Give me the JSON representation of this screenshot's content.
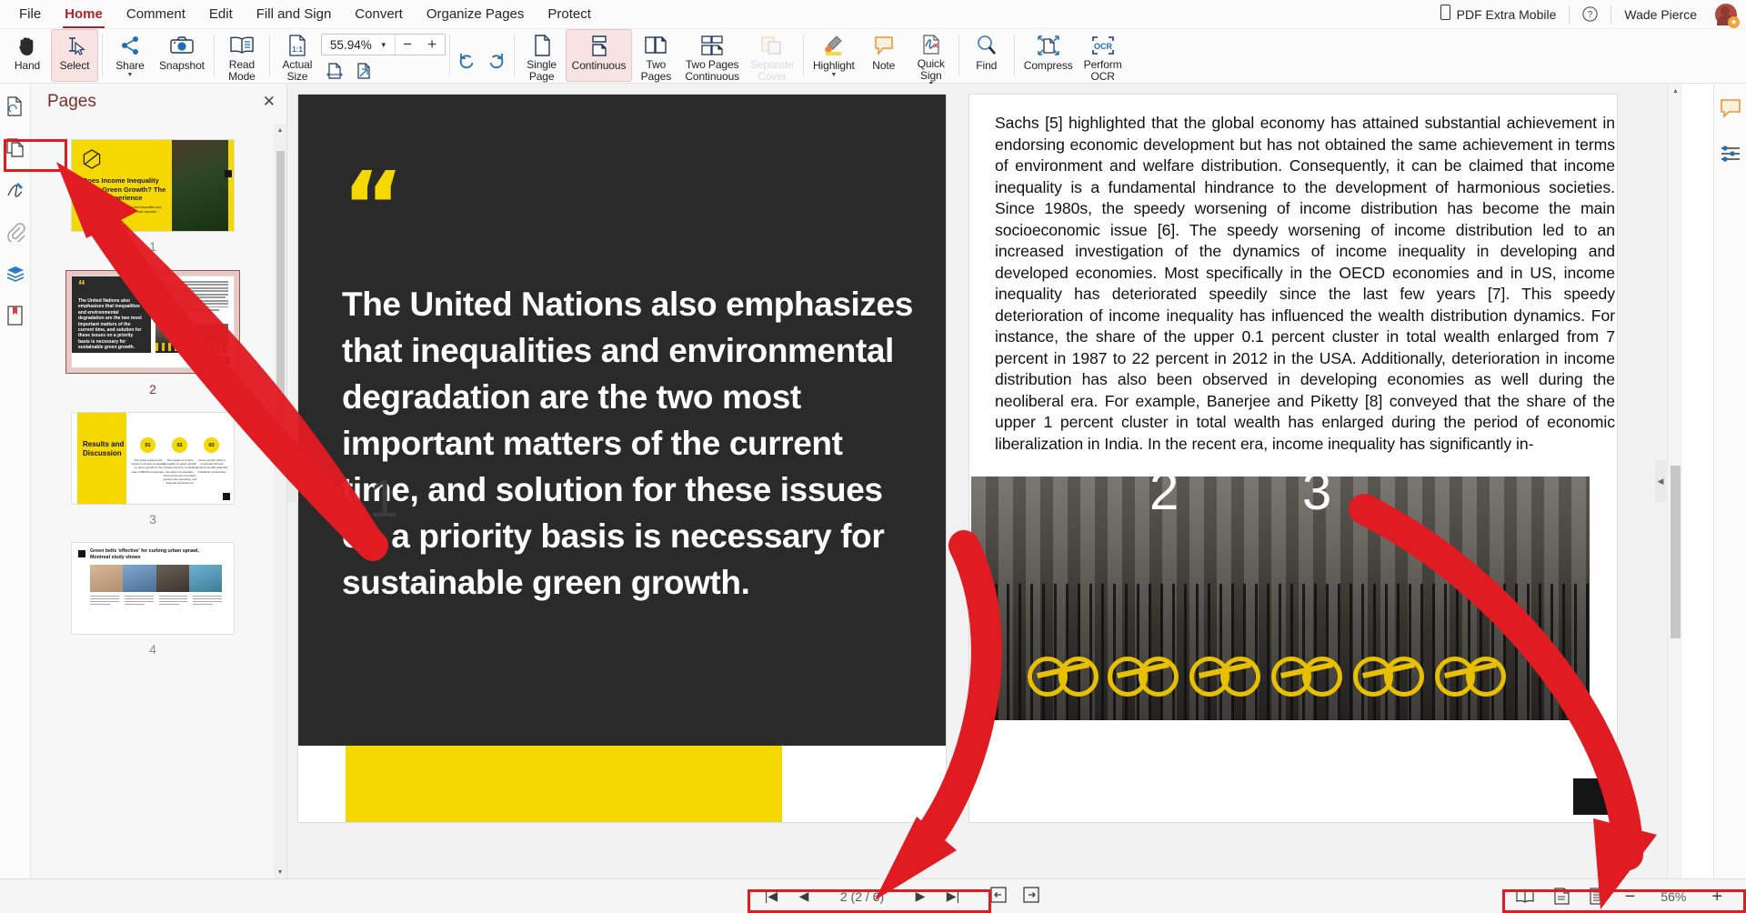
{
  "menu": {
    "items": [
      {
        "label": "File",
        "active": false
      },
      {
        "label": "Home",
        "active": true
      },
      {
        "label": "Comment",
        "active": false
      },
      {
        "label": "Edit",
        "active": false
      },
      {
        "label": "Fill and Sign",
        "active": false
      },
      {
        "label": "Convert",
        "active": false
      },
      {
        "label": "Organize Pages",
        "active": false
      },
      {
        "label": "Protect",
        "active": false
      }
    ],
    "mobile_label": "PDF Extra Mobile",
    "help_label": "?",
    "user_name": "Wade Pierce"
  },
  "ribbon": {
    "hand": "Hand",
    "select": "Select",
    "share": "Share",
    "snapshot": "Snapshot",
    "read_mode": "Read\nMode",
    "actual_size": "Actual\nSize",
    "zoom_value": "55.94%",
    "zoom_minus": "−",
    "zoom_plus": "+",
    "single_page": "Single\nPage",
    "continuous": "Continuous",
    "two_pages": "Two\nPages",
    "two_pages_continuous": "Two Pages\nContinuous",
    "separate_cover": "Separate\nCover",
    "highlight": "Highlight",
    "note": "Note",
    "quick_sign": "Quick\nSign",
    "find": "Find",
    "compress": "Compress",
    "perform_ocr": "Perform\nOCR"
  },
  "left_rail": {
    "items": [
      {
        "name": "thumbnail-page-icon"
      },
      {
        "name": "pages-icon"
      },
      {
        "name": "signature-icon"
      },
      {
        "name": "attachment-icon"
      },
      {
        "name": "layers-icon"
      },
      {
        "name": "bookmark-icon"
      }
    ],
    "pages_tab_label": "Pages"
  },
  "pages_panel": {
    "title": "Pages",
    "close_label": "✕",
    "thumbnails": [
      {
        "number": "1",
        "current": false,
        "kind": "title-slide",
        "title": "Does Income Inequality Harm Green Growth? The BRICS Experience",
        "subtitle": "The United Nations also emphasizes that inequalities and environmental degradation are the two most important matters of the current time."
      },
      {
        "number": "2",
        "current": true,
        "kind": "quote-article",
        "quote_mark": "“",
        "quote_text": "The United Nations also emphasizes that inequalities and environmental degradation are the two most important matters of the current time, and solution for these issues on a priority basis is necessary for sustainable green growth."
      },
      {
        "number": "3",
        "current": false,
        "kind": "results",
        "title": "Results and Discussion",
        "steps": [
          {
            "num": "01",
            "text": "The study explores the impact of income inequality on green growth in the case of BRICS economies."
          },
          {
            "num": "02",
            "text": "The impact of income inequality on green growth is determined by controlling the effect of education, socio-economic innovation, government spending, and financial development."
          },
          {
            "num": "03",
            "text": "Green growth (GG) is measured through environmentally adjusted multifactor productivity."
          }
        ]
      },
      {
        "number": "4",
        "current": false,
        "kind": "news",
        "title": "Green belts 'effective' for curbing urban sprawl, Montreal study shows"
      }
    ]
  },
  "document": {
    "left_page": {
      "quote_mark": "“",
      "text": "The United Nations also emphasizes that inequalities and environmental degradation are the two most important matters of the current time, and solution for these issues on a priority basis is necessary for sustainable green growth."
    },
    "right_page": {
      "paragraph_1": "Sachs [5] highlighted that the global economy has attained substantial achievement in endorsing economic development but has not obtained the same achievement in terms of environment and welfare distribution. Consequently, it can be claimed that income inequality is a fundamental hindrance to the development of harmonious societies. Since 1980s, the speedy worsening of income distribution has become the main socioeconomic issue [6]. The speedy worsening of income distribution led to an increased investigation of the dynamics of income inequality in developing and developed economies. Most specifically in the OECD economies and in US, income inequality has deteriorated speedily since the last few years [7]. This speedy deterioration of income inequality has influenced the wealth distribution dynamics. For instance, the share of the upper 0.1 percent cluster in total wealth enlarged from 7 percent in 1987 to 22 percent in 2012 in the USA. Additionally, deterioration in income distribution has also been observed in developing economies as well during the neoliberal era. For example, Banerjee and Piketty [8] conveyed that the share of the upper 1 percent cluster in total wealth has enlarged during the period of economic liberalization in India. In the recent era, income inequality has significantly in-"
    }
  },
  "right_rail": {
    "items": [
      {
        "name": "comment-bubble-icon"
      },
      {
        "name": "properties-list-icon"
      }
    ]
  },
  "statusbar": {
    "first_page_label": "|◀",
    "prev_page_label": "◀",
    "page_indicator": "2 (2 / 6)",
    "next_page_label": "▶",
    "last_page_label": "▶|",
    "insert_page_before_label": "insert-page-before-icon",
    "insert_page_after_label": "insert-page-after-icon",
    "view_book_label": "book-view-icon",
    "view_single_label": "single-page-view-icon",
    "view_continuous_label": "continuous-view-icon",
    "zoom_out_label": "−",
    "zoom_percent": "56%",
    "zoom_in_label": "+"
  },
  "annotations": {
    "marker_1": "1",
    "marker_2": "2",
    "marker_3": "3",
    "arrow_color": "#e11b22",
    "highlight_color": "#e11b22"
  },
  "colors": {
    "accent": "#a4262c",
    "brand_yellow": "#f5d800",
    "selected_tool": "#f6e3e2",
    "dark_slide": "#2a2a2a"
  }
}
